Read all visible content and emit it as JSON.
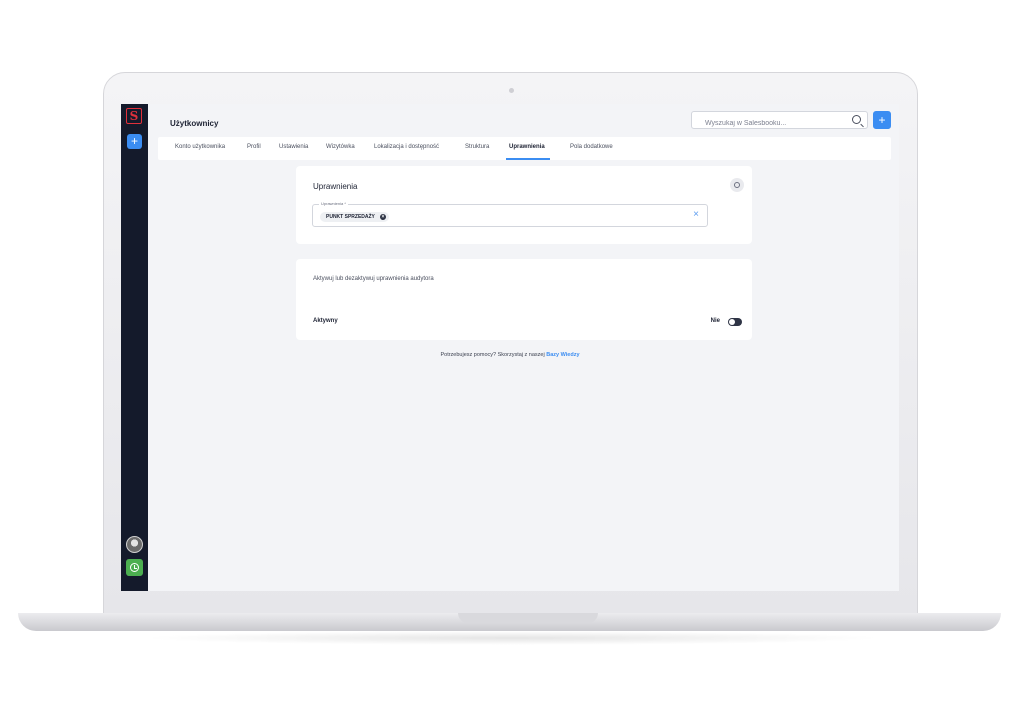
{
  "sidebar": {
    "logo_letter": "S",
    "add_label": "+",
    "avatar_icon": "user-avatar",
    "clock_icon": "clock-icon"
  },
  "header": {
    "title": "Użytkownicy",
    "search_placeholder": "Wyszukaj w Salesbooku...",
    "add_label": "+"
  },
  "tabs": [
    {
      "label": "Konto użytkownika"
    },
    {
      "label": "Profil"
    },
    {
      "label": "Ustawienia"
    },
    {
      "label": "Wizytówka"
    },
    {
      "label": "Lokalizacja i dostępność"
    },
    {
      "label": "Struktura"
    },
    {
      "label": "Uprawnienia",
      "active": true
    },
    {
      "label": "Pola dodatkowe"
    }
  ],
  "permissions_card": {
    "title": "Uprawnienia",
    "field_label": "Uprawnienia *",
    "chip_label": "PUNKT SPRZEDAŻY",
    "chip_remove": "×",
    "clear": "×"
  },
  "auditor_card": {
    "description": "Aktywuj lub dezaktywuj uprawnienia audytora",
    "label": "Aktywny",
    "toggle_text": "Nie"
  },
  "help": {
    "text": "Potrzebujesz pomocy? Skorzystaj z naszej ",
    "link": "Bazy Wiedzy"
  },
  "colors": {
    "accent": "#3b8df2",
    "sidebar": "#141a2b",
    "brand_red": "#e0303b",
    "clock_green": "#4caf50"
  }
}
